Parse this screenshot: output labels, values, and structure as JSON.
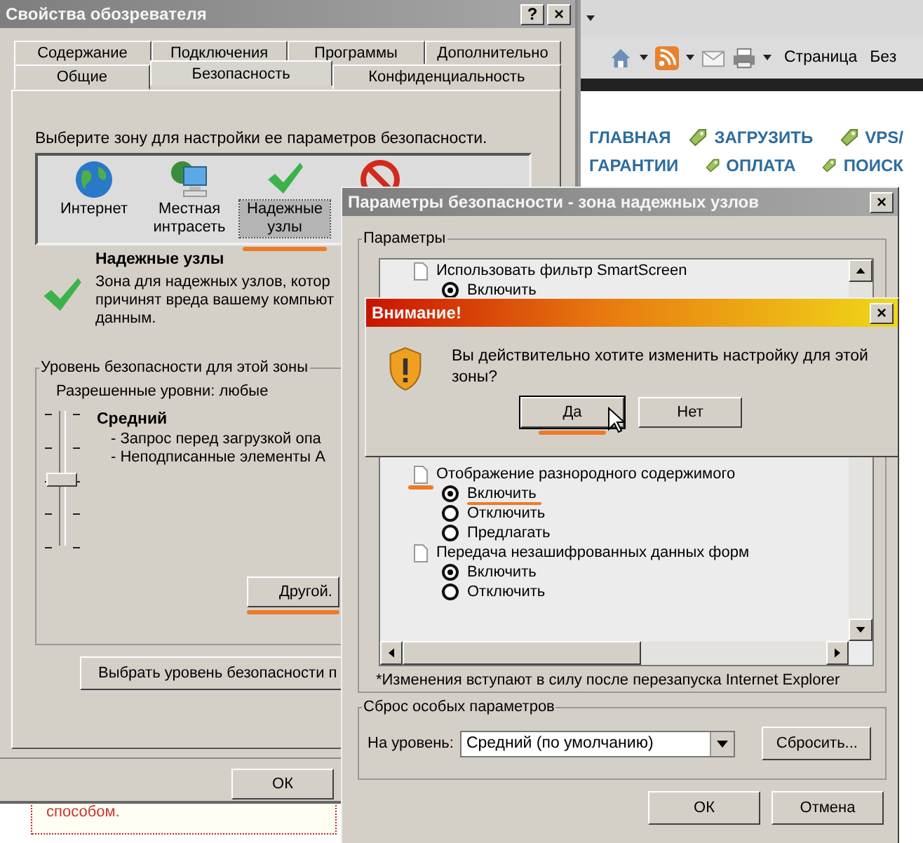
{
  "browser": {
    "menus": [
      "Страница",
      "Без"
    ],
    "nav_rows": [
      [
        {
          "label": "ГЛАВНАЯ",
          "tag": false
        },
        {
          "label": "ЗАГРУЗИТЬ",
          "tag": true
        },
        {
          "label": "VPS/",
          "tag": true
        }
      ],
      [
        {
          "label": "ГАРАНТИИ",
          "tag": false
        },
        {
          "label": "ОПЛАТА",
          "tag": true
        },
        {
          "label": "ПОИСК",
          "tag": true
        }
      ]
    ],
    "page_text": "способом."
  },
  "properties": {
    "title": "Свойства обозревателя",
    "help_button": "?",
    "close_button": "×",
    "tabs_back": [
      {
        "label": "Содержание",
        "selected": false
      },
      {
        "label": "Подключения",
        "selected": false
      },
      {
        "label": "Программы",
        "selected": false
      },
      {
        "label": "Дополнительно",
        "selected": false
      }
    ],
    "tabs_front": [
      {
        "label": "Общие",
        "selected": false
      },
      {
        "label": "Безопасность",
        "selected": true
      },
      {
        "label": "Конфиденциальность",
        "selected": false
      }
    ],
    "zone_prompt": "Выберите зону для настройки ее параметров безопасности.",
    "zones": [
      {
        "kind": "globe",
        "label": "Интернет",
        "selected": false
      },
      {
        "kind": "intranet",
        "label": "Местная интрасеть",
        "selected": false
      },
      {
        "kind": "trusted",
        "label": "Надежные узлы",
        "selected": true,
        "marked": true
      },
      {
        "kind": "restricted",
        "selected": false
      }
    ],
    "zone_title": "Надежные узлы",
    "zone_description": [
      "Зона для надежных узлов, котор",
      "причинят вреда вашему компьют",
      "данным."
    ],
    "level_group": "Уровень безопасности для этой зоны",
    "allowed_levels": "Разрешенные уровни: любые",
    "slider": {
      "level": 0.5
    },
    "level_name": "Средний",
    "level_points": [
      "- Запрос перед загрузкой опа",
      "- Неподписанные элементы А"
    ],
    "custom_button": {
      "label": "Другой.",
      "marked": true
    },
    "default_button": "Выбрать уровень безопасности п",
    "ok_button": "ОК"
  },
  "settings": {
    "title": "Параметры безопасности - зона надежных узлов",
    "close_button": "×",
    "group": "Параметры",
    "top_items": [
      {
        "label": "Использовать фильтр SmartScreen",
        "options": [
          {
            "label": "Включить",
            "selected": true
          }
        ]
      }
    ],
    "bottom_items": [
      {
        "label": "Отображение разнородного содержимого",
        "marked": true,
        "options": [
          {
            "label": "Включить",
            "selected": true,
            "marked": true
          },
          {
            "label": "Отключить",
            "selected": false
          },
          {
            "label": "Предлагать",
            "selected": false
          }
        ]
      },
      {
        "label": "Передача незашифрованных данных форм",
        "options": [
          {
            "label": "Включить",
            "selected": true
          },
          {
            "label": "Отключить",
            "selected": false
          }
        ]
      }
    ],
    "note": "*Изменения вступают в силу после перезапуска Internet Explorer",
    "reset_group": "Сброс особых параметров",
    "reset_label": "На уровень:",
    "reset_value": "Средний (по умолчанию)",
    "reset_button": "Сбросить...",
    "ok_button": "ОК",
    "cancel_button": "Отмена"
  },
  "alert": {
    "title": "Внимание!",
    "close_button": "×",
    "message": "Вы действительно хотите изменить настройку для этой зоны?",
    "buttons": [
      {
        "label": "Да",
        "marked": true
      },
      {
        "label": "Нет"
      }
    ]
  }
}
